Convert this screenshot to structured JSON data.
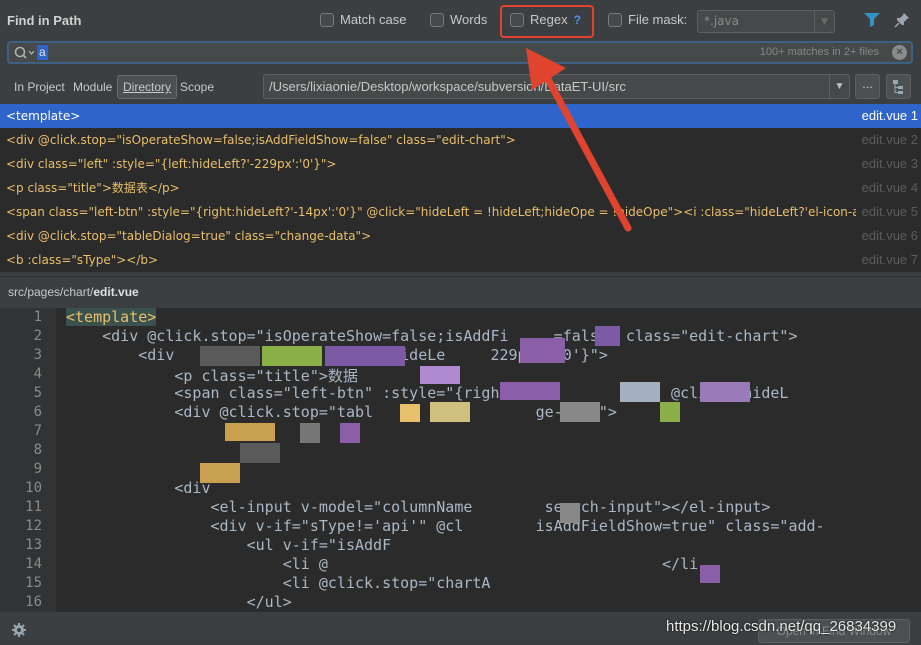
{
  "header": {
    "title": "Find in Path",
    "options": [
      {
        "label": "Match case",
        "checked": false
      },
      {
        "label": "Words",
        "checked": false
      },
      {
        "label": "Regex",
        "checked": false,
        "help": "?"
      },
      {
        "label": "File mask:",
        "checked": false
      }
    ],
    "file_mask_placeholder": "*.java",
    "icons": [
      "filter-icon",
      "pin-icon"
    ]
  },
  "search": {
    "value": "a",
    "matches": "100+ matches in 2+ files"
  },
  "scope": {
    "tabs": [
      {
        "label": "In Project",
        "selected": false
      },
      {
        "label": "Module",
        "selected": false
      },
      {
        "label": "Directory",
        "selected": true
      },
      {
        "label": "Scope",
        "selected": false
      }
    ],
    "path": "/Users/lixiaonie/Desktop/workspace/subversion/DataET-UI/src",
    "browse_label": "..."
  },
  "results": [
    {
      "code": "<template>",
      "file": "edit.vue 1"
    },
    {
      "code": "<div @click.stop=\"isOperateShow=false;isAddFieldShow=false\" class=\"edit-chart\">",
      "file": "edit.vue 2"
    },
    {
      "code": "<div class=\"left\" :style=\"{left:hideLeft?'-229px':'0'}\">",
      "file": "edit.vue 3"
    },
    {
      "code": "<p class=\"title\">数据表</p>",
      "file": "edit.vue 4"
    },
    {
      "code": "<span class=\"left-btn\" :style=\"{right:hideLeft?'-14px':'0'}\" @click=\"hideLeft = !hideLeft;hideOpe = !hideOpe\"><i :class=\"hideLeft?'el-icon-a",
      "file": "edit.vue 5"
    },
    {
      "code": "<div @click.stop=\"tableDialog=true\" class=\"change-data\">",
      "file": "edit.vue 6"
    },
    {
      "code": "<b :class=\"sType\"></b>",
      "file": "edit.vue 7"
    }
  ],
  "preview": {
    "path_prefix": "src/pages/chart/",
    "path_file": "edit.vue",
    "line_numbers": [
      "1",
      "2",
      "3",
      "4",
      "5",
      "6",
      "7",
      "8",
      "9",
      "10",
      "11",
      "12",
      "13",
      "14",
      "15",
      "16"
    ],
    "lines": [
      "<template>",
      "    <div @click.stop=\"isOperateShow=false;isAddFi     =false\" class=\"edit-chart\">",
      "        <div                   left:hideLe     229px':'0'}\">",
      "            <p class=\"title\">数据",
      "            <span class=\"left-btn\" :style=\"{right:hi         '0'}\" @click=\"hideL",
      "            <div @click.stop=\"tabl                  ge-data\">",
      "",
      "",
      "",
      "            <div",
      "                <el-input v-model=\"columnName        search-input\"></el-input>",
      "                <div v-if=\"sType!='api'\" @cl        isAddFieldShow=true\" class=\"add-",
      "                    <ul v-if=\"isAddF",
      "                        <li @                                     </li",
      "                        <li @click.stop=\"chartA",
      "                    </ul>"
    ]
  },
  "footer": {
    "open_button": "Open in Find Window",
    "watermark": "https://blog.csdn.net/qq_26834399"
  },
  "colors": {
    "accent": "#2f65ca",
    "highlight_box": "#e0442e",
    "tag": "#e8bf6a",
    "string": "#6a8759"
  }
}
